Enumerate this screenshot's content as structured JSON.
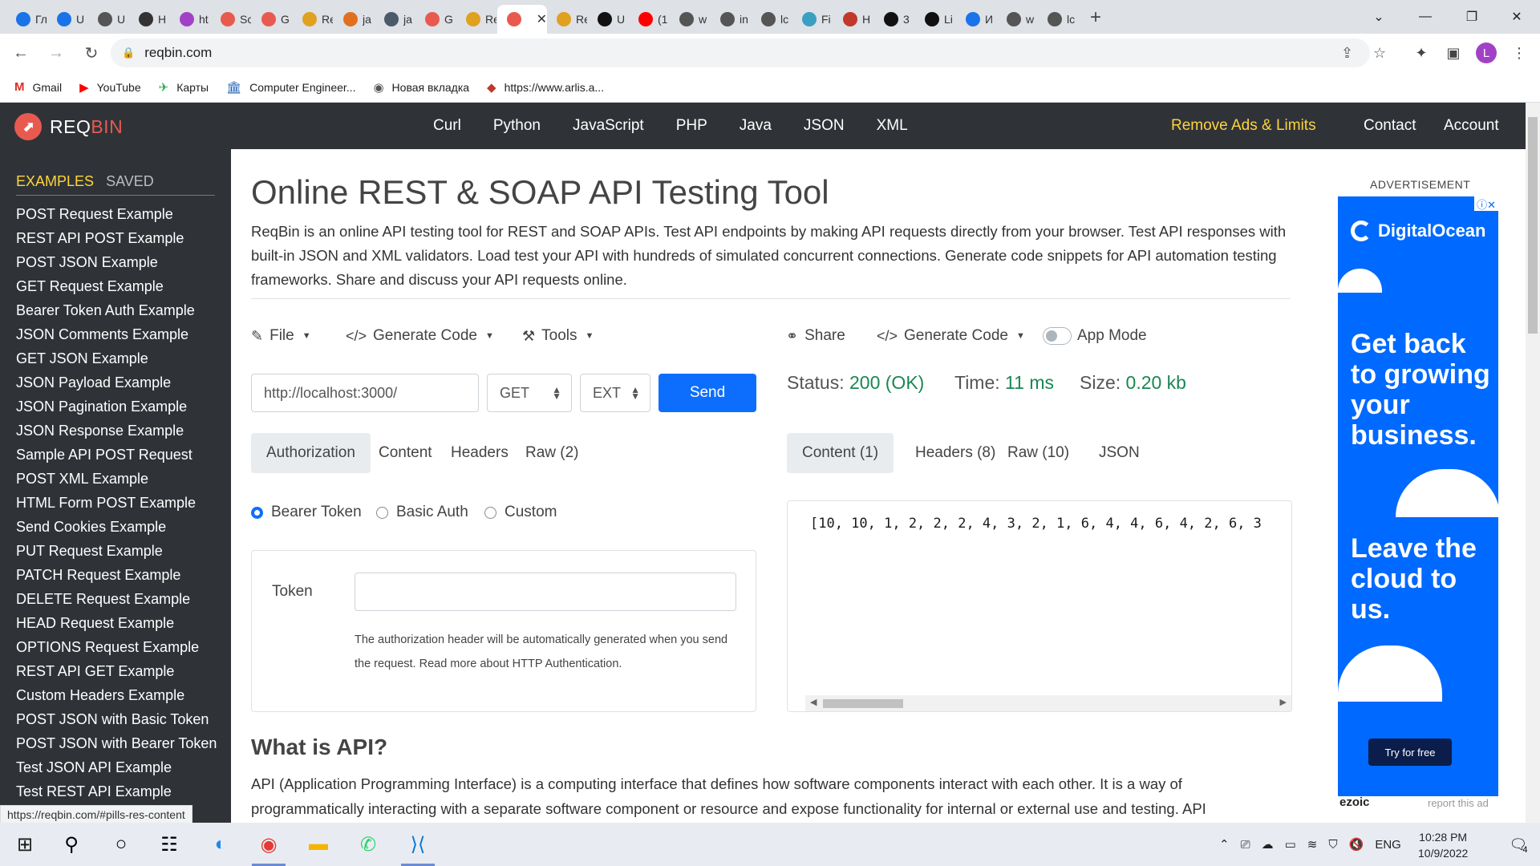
{
  "browser": {
    "tabs": [
      {
        "title": "Гл",
        "color": "#1a73e8"
      },
      {
        "title": "U",
        "color": "#1a73e8"
      },
      {
        "title": "U",
        "color": "#555555"
      },
      {
        "title": "H",
        "color": "#333333"
      },
      {
        "title": "ht",
        "color": "#a142c6"
      },
      {
        "title": "Sc",
        "color": "#e85a4f"
      },
      {
        "title": "G",
        "color": "#e85a4f"
      },
      {
        "title": "Re",
        "color": "#e0a020"
      },
      {
        "title": "ja",
        "color": "#e07020"
      },
      {
        "title": "ja",
        "color": "#4a5a6a"
      },
      {
        "title": "G",
        "color": "#e85a4f"
      },
      {
        "title": "Re",
        "color": "#e0a020"
      },
      {
        "title": "",
        "color": "#e85a4f",
        "active": true
      },
      {
        "title": "Re",
        "color": "#e0a020"
      },
      {
        "title": "U",
        "color": "#111111"
      },
      {
        "title": "(1",
        "color": "#ff0000"
      },
      {
        "title": "w",
        "color": "#555555"
      },
      {
        "title": "in",
        "color": "#555555"
      },
      {
        "title": "lc",
        "color": "#555555"
      },
      {
        "title": "Fi",
        "color": "#3aa0c0"
      },
      {
        "title": "H",
        "color": "#c0392b"
      },
      {
        "title": "3",
        "color": "#111111"
      },
      {
        "title": "Li",
        "color": "#111111"
      },
      {
        "title": "И",
        "color": "#1a73e8"
      },
      {
        "title": "w",
        "color": "#555555"
      },
      {
        "title": "lc",
        "color": "#555555"
      }
    ],
    "url": "reqbin.com",
    "bookmarks": [
      {
        "label": "Gmail",
        "icon": "gmail-icon"
      },
      {
        "label": "YouTube",
        "icon": "youtube-icon"
      },
      {
        "label": "Карты",
        "icon": "maps-icon"
      },
      {
        "label": "Computer Engineer...",
        "icon": "building-icon"
      },
      {
        "label": "Новая вкладка",
        "icon": "globe-icon"
      },
      {
        "label": "https://www.arlis.a...",
        "icon": "arlis-icon"
      }
    ],
    "profile_letter": "L",
    "status_url": "https://reqbin.com/#pills-res-content"
  },
  "header": {
    "logo_req": "REQ",
    "logo_bin": "BIN",
    "nav": [
      "Curl",
      "Python",
      "JavaScript",
      "PHP",
      "Java",
      "JSON",
      "XML"
    ],
    "remove_ads": "Remove Ads & Limits",
    "contact": "Contact",
    "account": "Account"
  },
  "sidebar": {
    "tab_examples": "EXAMPLES",
    "tab_saved": "SAVED",
    "items": [
      "POST Request Example",
      "REST API POST Example",
      "POST JSON Example",
      "GET Request Example",
      "Bearer Token Auth Example",
      "JSON Comments Example",
      "GET JSON Example",
      "JSON Payload Example",
      "JSON Pagination Example",
      "JSON Response Example",
      "Sample API POST Request",
      "POST XML Example",
      "HTML Form POST Example",
      "Send Cookies Example",
      "PUT Request Example",
      "PATCH Request Example",
      "DELETE Request Example",
      "HEAD Request Example",
      "OPTIONS Request Example",
      "REST API GET Example",
      "Custom Headers Example",
      "POST JSON with Basic Token",
      "POST JSON with Bearer Token",
      "Test JSON API Example",
      "Test REST API Example"
    ]
  },
  "main": {
    "title": "Online REST & SOAP API Testing Tool",
    "intro": "ReqBin is an online API testing tool for REST and SOAP APIs. Test API endpoints by making API requests directly from your browser. Test API responses with built-in JSON and XML validators. Load test your API with hundreds of simulated concurrent connections. Generate code snippets for API automation testing frameworks. Share and discuss your API requests online.",
    "req_toolbar": {
      "file": "File",
      "generate_code": "Generate Code",
      "tools": "Tools"
    },
    "resp_toolbar": {
      "share": "Share",
      "generate_code": "Generate Code",
      "app_mode": "App Mode"
    },
    "request": {
      "url": "http://localhost:3000/",
      "method": "GET",
      "ext": "EXT",
      "send": "Send"
    },
    "req_tabs": [
      "Authorization",
      "Content",
      "Headers",
      "Raw (2)"
    ],
    "auth_options": [
      "Bearer Token",
      "Basic Auth",
      "Custom"
    ],
    "auth_selected": "Bearer Token",
    "token_label": "Token",
    "token_value": "",
    "token_help": "The authorization header will be automatically generated when you send the request. Read more about HTTP Authentication.",
    "response": {
      "status_label": "Status:",
      "status_value": "200 (OK)",
      "time_label": "Time:",
      "time_value": "11 ms",
      "size_label": "Size:",
      "size_value": "0.20 kb",
      "tabs": [
        "Content (1)",
        "Headers (8)",
        "Raw (10)",
        "JSON"
      ],
      "body": "[10, 10, 1, 2, 2, 2, 4, 3, 2, 1, 6, 4, 4, 6, 4, 2, 6, 3"
    },
    "what_title": "What is API?",
    "what_text": "API (Application Programming Interface) is a computing interface that defines how software components interact with each other. It is a way of programmatically interacting with a separate software component or resource and expose functionality for internal or external use and testing. API"
  },
  "ad": {
    "label": "ADVERTISEMENT",
    "brand": "DigitalOcean",
    "headline1": "Get back to growing your business.",
    "headline2": "Leave the cloud to us.",
    "cta": "Try for free",
    "ezoic": "ezoic",
    "report": "report this ad",
    "accent": "#0069ff"
  },
  "taskbar": {
    "lang": "ENG",
    "time": "10:28 PM",
    "date": "10/9/2022",
    "notifications": "4"
  }
}
